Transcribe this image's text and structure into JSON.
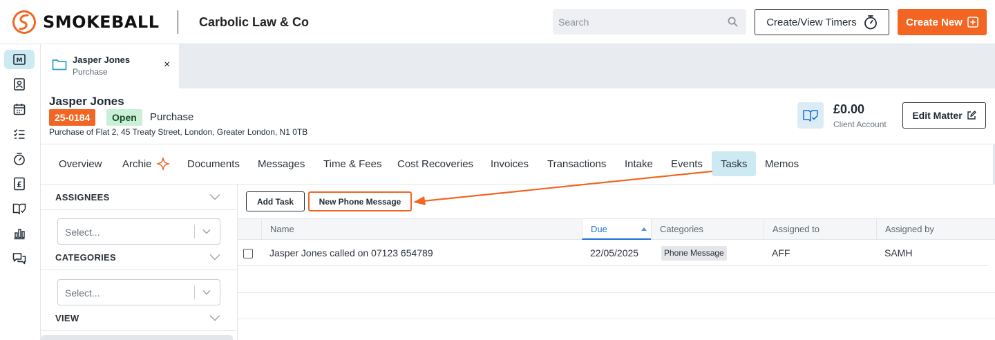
{
  "header": {
    "logo_text": "SMOKEBALL",
    "firm_name": "Carbolic Law & Co",
    "search_placeholder": "Search",
    "timers_button": "Create/View Timers",
    "create_button": "Create New",
    "brand_color": "#f26522"
  },
  "rail": {
    "items": [
      "matters-icon",
      "contacts-icon",
      "calendar-icon",
      "tasks-icon",
      "timer-icon",
      "billing-icon",
      "documents-icon",
      "reports-icon",
      "communicate-icon"
    ],
    "active_index": 0
  },
  "matter_tab": {
    "name": "Jasper Jones",
    "type": "Purchase",
    "close": "×"
  },
  "matter": {
    "client_name": "Jasper Jones",
    "number": "25-0184",
    "status": "Open",
    "matter_type": "Purchase",
    "description": "Purchase of Flat 2, 45 Treaty Street, London, Greater London, N1 0TB",
    "balance": "£0.00",
    "balance_label": "Client Account",
    "edit_button": "Edit Matter"
  },
  "tabs": [
    {
      "label": "Overview"
    },
    {
      "label": "Archie"
    },
    {
      "label": "Documents"
    },
    {
      "label": "Messages"
    },
    {
      "label": "Time & Fees"
    },
    {
      "label": "Cost Recoveries"
    },
    {
      "label": "Invoices"
    },
    {
      "label": "Transactions"
    },
    {
      "label": "Intake"
    },
    {
      "label": "Events"
    },
    {
      "label": "Tasks"
    },
    {
      "label": "Memos"
    }
  ],
  "active_tab": "Tasks",
  "filters": {
    "assignees": {
      "heading": "ASSIGNEES",
      "placeholder": "Select..."
    },
    "categories": {
      "heading": "CATEGORIES",
      "placeholder": "Select..."
    },
    "view": {
      "heading": "VIEW"
    }
  },
  "toolbar": {
    "add_task": "Add Task",
    "new_phone_message": "New Phone Message"
  },
  "table": {
    "columns": [
      "Name",
      "Due",
      "Categories",
      "Assigned to",
      "Assigned by"
    ],
    "sorted_column": "Due",
    "sort_direction": "ascending",
    "rows": [
      {
        "name": "Jasper Jones called on 07123 654789",
        "due": "22/05/2025",
        "category": "Phone Message",
        "assigned_to": "AFF",
        "assigned_by": "SAMH"
      }
    ]
  }
}
